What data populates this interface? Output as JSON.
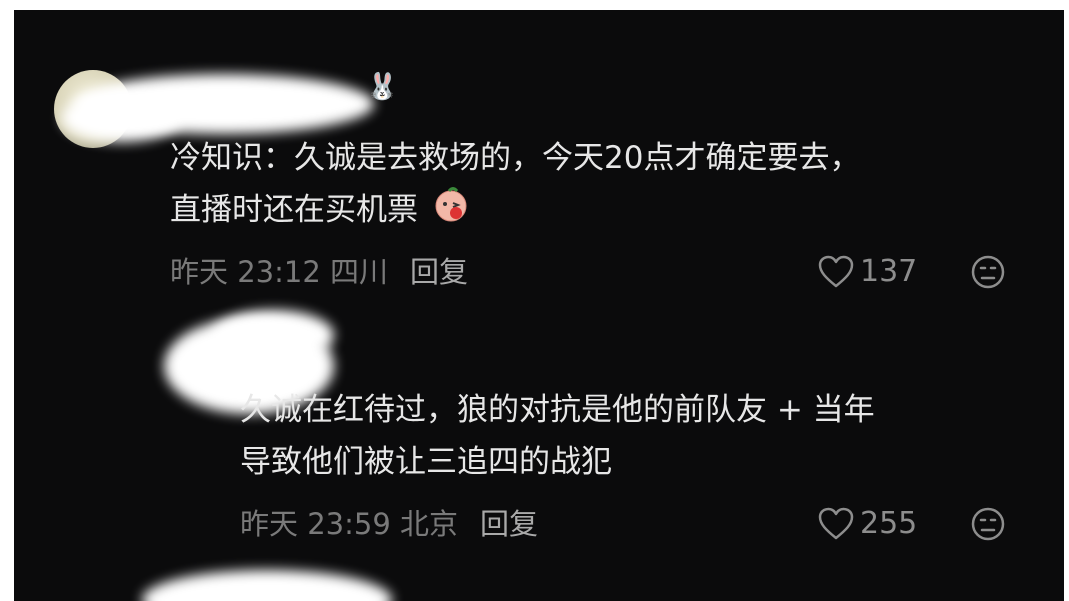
{
  "comments": [
    {
      "text_line1": "冷知识：久诚是去救场的，今天20点才确定要去，",
      "text_line2": "直播时还在买机票",
      "time": "昨天 23:12 四川",
      "reply_label": "回复",
      "likes": "137",
      "like_icon": "heart-outline-icon",
      "dislike_icon": "frown-face-icon"
    },
    {
      "text_line1": "久诚在红待过，狼的对抗是他的前队友 + 当年",
      "text_line2": "导致他们被让三追四的战犯",
      "time": "昨天 23:59 北京",
      "reply_label": "回复",
      "likes": "255",
      "like_icon": "heart-outline-icon",
      "dislike_icon": "frown-face-icon"
    }
  ],
  "colors": {
    "background": "#0b0b0c",
    "text": "#e7e7e7",
    "meta": "#7a7a7a",
    "banner": "#f6e400"
  }
}
